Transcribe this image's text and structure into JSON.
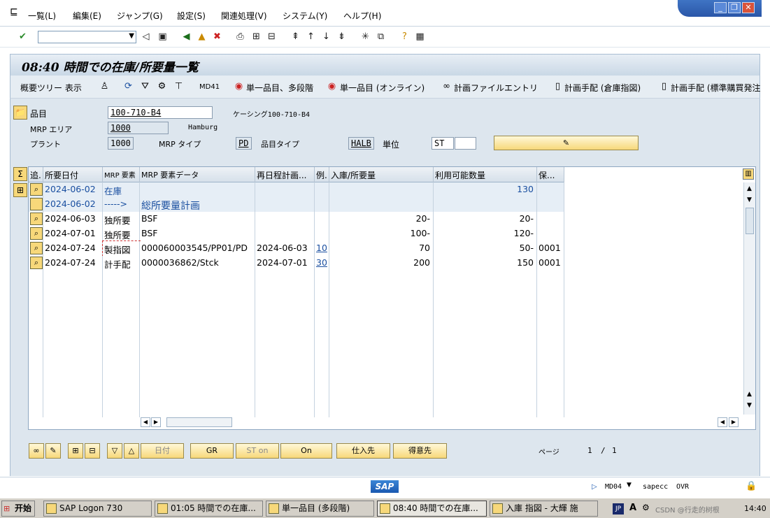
{
  "menu": {
    "items": [
      "一覧(L)",
      "編集(E)",
      "ジャンプ(G)",
      "設定(S)",
      "関連処理(V)",
      "システム(Y)",
      "ヘルプ(H)"
    ]
  },
  "window": {
    "minimize": "_",
    "restore": "❐",
    "close": "✕"
  },
  "title": "08:40 時間での在庫/所要量一覧",
  "app_toolbar": {
    "tree_label": "概要ツリー 表示",
    "md41": "MD41",
    "single_multi": "単一品目、多段階",
    "single_online": "単一品目 (オンライン)",
    "plan_file": "計画ファイルエントリ",
    "plan_order_warehouse": "計画手配 (倉庫指図)",
    "plan_order_std": "計画手配 (標準購買発注"
  },
  "header": {
    "material_label": "品目",
    "material_value": "100-710-B4",
    "casing_text": "ケーシング100-710-B4",
    "mrp_area_label": "MRP エリア",
    "mrp_area_value": "1000",
    "mrp_area_name": "Hamburg",
    "plant_label": "プラント",
    "plant_value": "1000",
    "mrp_type_label": "MRP タイプ",
    "mrp_type_value": "PD",
    "material_type_label": "品目タイプ",
    "material_type_value": "HALB",
    "unit_label": "単位",
    "unit_value": "ST"
  },
  "grid": {
    "columns": [
      "追.",
      "所要日付",
      "MRP 要素",
      "MRP 要素データ",
      "再日程計画...",
      "例.",
      "入庫/所要量",
      "利用可能数量",
      "保..."
    ],
    "rows": [
      {
        "date": "2024-06-02",
        "element": "在庫",
        "data": "",
        "resched": "",
        "ex": "",
        "qty": "",
        "avail": "130",
        "res": "",
        "style": "blue"
      },
      {
        "date": "2024-06-02",
        "element": "----->",
        "data": "総所要量計画",
        "resched": "",
        "ex": "",
        "qty": "",
        "avail": "",
        "res": "",
        "style": "blue"
      },
      {
        "date": "2024-06-03",
        "element": "独所要",
        "data": "BSF",
        "resched": "",
        "ex": "",
        "qty": "20-",
        "avail": "20-",
        "res": "",
        "style": "plain"
      },
      {
        "date": "2024-07-01",
        "element": "独所要",
        "data": "BSF",
        "resched": "",
        "ex": "",
        "qty": "100-",
        "avail": "120-",
        "res": "",
        "style": "plain"
      },
      {
        "date": "2024-07-24",
        "element": "製指図",
        "data": "000060003545/PP01/PD",
        "resched": "2024-06-03",
        "ex": "10",
        "qty": "70",
        "avail": "50-",
        "res": "0001",
        "style": "plain"
      },
      {
        "date": "2024-07-24",
        "element": "計手配",
        "data": "0000036862/Stck",
        "resched": "2024-07-01",
        "ex": "30",
        "qty": "200",
        "avail": "150",
        "res": "0001",
        "style": "plain"
      }
    ]
  },
  "bottom_buttons": {
    "date": "日付",
    "gr": "GR",
    "st_on": "ST on",
    "on": "On",
    "vendor": "仕入先",
    "customer": "得意先",
    "page_label": "ページ",
    "page_current": "1",
    "page_sep": "/",
    "page_total": "1"
  },
  "status": {
    "tcode": "MD04",
    "server": "sapecc",
    "mode": "OVR"
  },
  "taskbar": {
    "start": "开始",
    "items": [
      "SAP Logon 730",
      "01:05 時間での在庫...",
      "単一品目 (多段階)",
      "08:40 時間での在庫...",
      "入庫 指図 - 大輝 施"
    ],
    "lang": "JP",
    "clock": "14:40",
    "watermark": "CSDN @行走的树根"
  },
  "colors": {
    "accent_blue": "#1a4fa0",
    "button_yellow": "#f7d87a",
    "panel_bg": "#dde6ee"
  }
}
